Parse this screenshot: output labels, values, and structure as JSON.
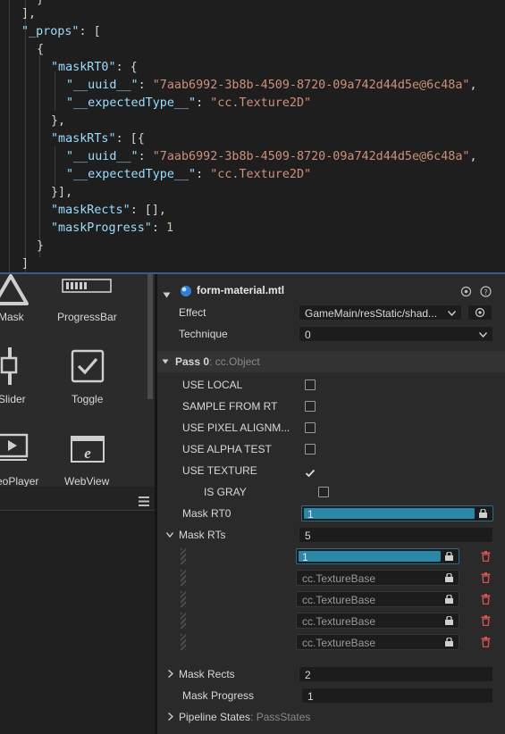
{
  "code": {
    "l0": "}",
    "l1": "],",
    "l2_key": "\"_props\"",
    "l2_rest": ": [",
    "l3": "{",
    "l4_key": "\"maskRT0\"",
    "l4_rest": ": {",
    "l5_key": "\"__uuid__\"",
    "l5_val": "\"7aab6992-3b8b-4509-8720-09a742d44d5e@6c48a\"",
    "l6_key": "\"__expectedType__\"",
    "l6_val": "\"cc.Texture2D\"",
    "l7": "},",
    "l8_key": "\"maskRTs\"",
    "l8_rest": ": [{",
    "l9_key": "\"__uuid__\"",
    "l9_val": "\"7aab6992-3b8b-4509-8720-09a742d44d5e@6c48a\"",
    "l10_key": "\"__expectedType__\"",
    "l10_val": "\"cc.Texture2D\"",
    "l11": "}],",
    "l12_key": "\"maskRects\"",
    "l12_rest": ": [],",
    "l13_key": "\"maskProgress\"",
    "l13_num": "1",
    "l14": "}",
    "l15": "]"
  },
  "components": [
    {
      "label": "Mask",
      "icon": "mask-icon"
    },
    {
      "label": "ProgressBar",
      "icon": "progressbar-icon"
    },
    {
      "label": "Slider",
      "icon": "slider-icon"
    },
    {
      "label": "Toggle",
      "icon": "toggle-icon"
    },
    {
      "label": "eoPlayer",
      "icon": "videoplayer-icon"
    },
    {
      "label": "WebView",
      "icon": "webview-icon"
    }
  ],
  "inspector": {
    "title": "form-material.mtl",
    "effect_label": "Effect",
    "effect_value": "GameMain/resStatic/shad...",
    "technique_label": "Technique",
    "technique_value": "0",
    "pass_title": "Pass 0",
    "pass_type": ": cc.Object",
    "options": [
      {
        "label": "USE LOCAL",
        "checked": false
      },
      {
        "label": "SAMPLE FROM RT",
        "checked": false
      },
      {
        "label": "USE PIXEL ALIGNM...",
        "checked": false
      },
      {
        "label": "USE ALPHA TEST",
        "checked": false
      },
      {
        "label": "USE TEXTURE",
        "checked": true
      },
      {
        "label": "IS GRAY",
        "checked": false
      }
    ],
    "mask_rt0_label": "Mask RT0",
    "mask_rt0_value": "1",
    "mask_rts_label": "Mask RTs",
    "mask_rts_count": "5",
    "mask_rts_items": [
      "1",
      "cc.TextureBase",
      "cc.TextureBase",
      "cc.TextureBase",
      "cc.TextureBase"
    ],
    "mask_rects_label": "Mask Rects",
    "mask_rects_value": "2",
    "mask_progress_label": "Mask Progress",
    "mask_progress_value": "1",
    "pipeline_label": "Pipeline States",
    "pipeline_type": ": PassStates"
  },
  "colors": {
    "accent": "#2b87a7",
    "delete": "#d9534f",
    "divider": "#3a5a8a"
  }
}
